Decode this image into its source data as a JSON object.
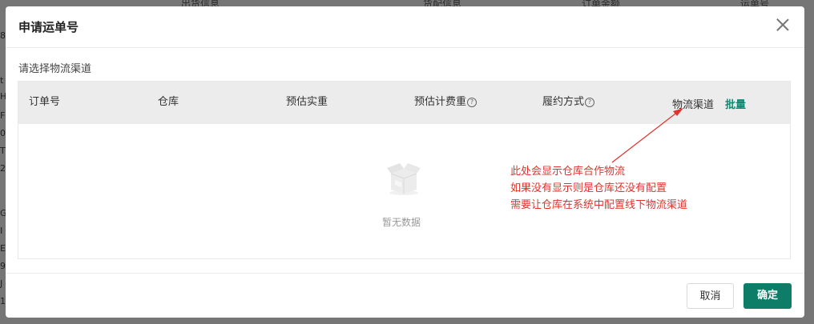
{
  "background": {
    "header_fragments": [
      "出货信息",
      "货配信息",
      "订单金额",
      "运单号"
    ],
    "left_edge_chars": [
      "8",
      "t",
      "H",
      "F",
      "0",
      "T",
      "2",
      "G",
      "I",
      "E",
      "9",
      "J",
      "1"
    ]
  },
  "modal": {
    "title": "申请运单号",
    "section_label": "请选择物流渠道",
    "table": {
      "columns": [
        "订单号",
        "仓库",
        "预估实重",
        "预估计费重",
        "履约方式",
        "物流渠道"
      ],
      "help_icon_glyph": "?",
      "batch_label": "批量",
      "empty_text": "暂无数据"
    },
    "annotation_lines": [
      "此处会显示仓库合作物流",
      "如果没有显示则是仓库还没有配置",
      "需要让仓库在系统中配置线下物流渠道"
    ],
    "footer": {
      "cancel_label": "取消",
      "ok_label": "确定"
    }
  },
  "colors": {
    "primary": "#0d7d68",
    "link": "#0f8a73",
    "annotation": "#e0332d",
    "overlay": "#767676"
  }
}
